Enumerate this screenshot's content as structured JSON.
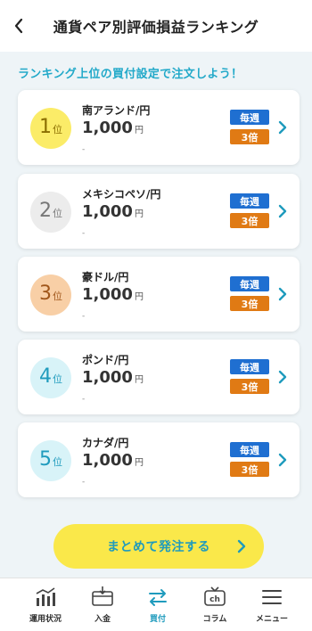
{
  "header": {
    "title": "通貨ペア別評価損益ランキング"
  },
  "subtitle": "ランキング上位の買付設定で注文しよう！",
  "rankings": [
    {
      "rank": "1",
      "rank_suffix": "位",
      "pair": "南アランド/円",
      "amount": "1,000",
      "unit": "円",
      "note": "-",
      "frequency": "毎週",
      "multiplier": "3倍",
      "medal_color": "#fbec68",
      "medal_text_color": "#8a6d00"
    },
    {
      "rank": "2",
      "rank_suffix": "位",
      "pair": "メキシコペソ/円",
      "amount": "1,000",
      "unit": "円",
      "note": "-",
      "frequency": "毎週",
      "multiplier": "3倍",
      "medal_color": "#ececec",
      "medal_text_color": "#777777"
    },
    {
      "rank": "3",
      "rank_suffix": "位",
      "pair": "豪ドル/円",
      "amount": "1,000",
      "unit": "円",
      "note": "-",
      "frequency": "毎週",
      "multiplier": "3倍",
      "medal_color": "#f8cfa6",
      "medal_text_color": "#a0561a"
    },
    {
      "rank": "4",
      "rank_suffix": "位",
      "pair": "ポンド/円",
      "amount": "1,000",
      "unit": "円",
      "note": "-",
      "frequency": "毎週",
      "multiplier": "3倍",
      "medal_color": "#d8f3f8",
      "medal_text_color": "#1f9bbd"
    },
    {
      "rank": "5",
      "rank_suffix": "位",
      "pair": "カナダ/円",
      "amount": "1,000",
      "unit": "円",
      "note": "-",
      "frequency": "毎週",
      "multiplier": "3倍",
      "medal_color": "#d8f3f8",
      "medal_text_color": "#1f9bbd"
    }
  ],
  "order_button": {
    "label": "まとめて発注する"
  },
  "tabbar": {
    "items": [
      {
        "label": "運用状況",
        "icon": "chart-icon"
      },
      {
        "label": "入金",
        "icon": "deposit-icon"
      },
      {
        "label": "買付",
        "icon": "exchange-icon",
        "active": true
      },
      {
        "label": "コラム",
        "icon": "column-icon"
      },
      {
        "label": "メニュー",
        "icon": "menu-icon"
      }
    ]
  },
  "colors": {
    "accent": "#1f9bbd",
    "badge_blue": "#1f6fd1",
    "badge_orange": "#e07a14",
    "button_yellow": "#fae84a"
  }
}
